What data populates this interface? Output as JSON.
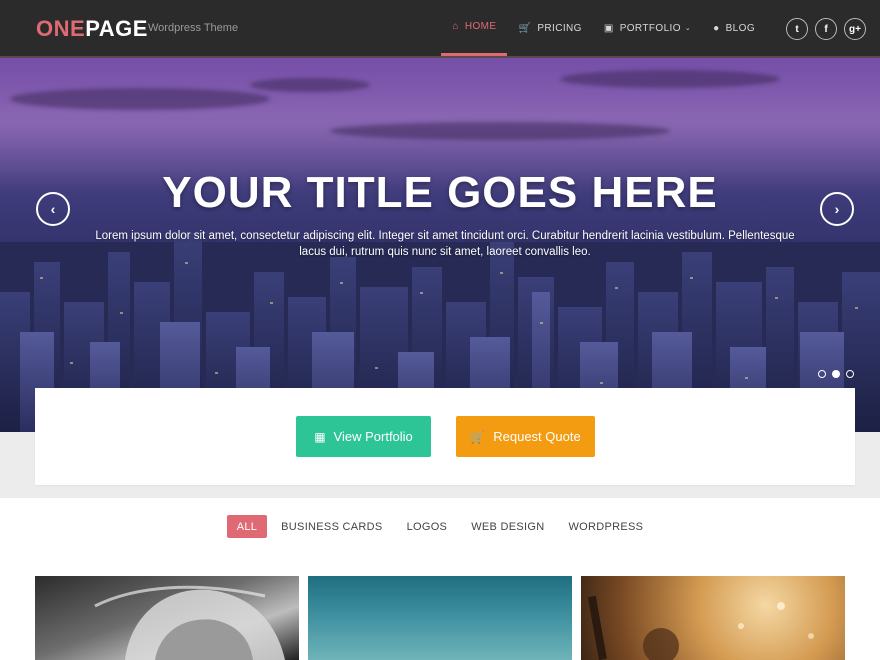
{
  "brand": {
    "part1": "ONE",
    "part2": "PAGE",
    "tagline": "Wordpress Theme"
  },
  "nav": [
    {
      "label": "HOME",
      "icon": "home-icon",
      "glyph": "⌂",
      "active": true
    },
    {
      "label": "PRICING",
      "icon": "cart-icon",
      "glyph": "🛒"
    },
    {
      "label": "PORTFOLIO",
      "icon": "image-icon",
      "glyph": "▣",
      "caret": "⌄"
    },
    {
      "label": "BLOG",
      "icon": "chat-icon",
      "glyph": "●"
    }
  ],
  "social": [
    {
      "icon": "twitter-icon",
      "glyph": "t"
    },
    {
      "icon": "facebook-icon",
      "glyph": "f"
    },
    {
      "icon": "google-plus-icon",
      "glyph": "g+"
    }
  ],
  "hero": {
    "title": "YOUR TITLE GOES HERE",
    "text": "Lorem ipsum dolor sit amet, consectetur adipiscing elit. Integer sit amet tincidunt orci. Curabitur hendrerit lacinia vestibulum. Pellentesque lacus dui, rutrum quis nunc sit amet, laoreet convallis leo.",
    "prev_glyph": "‹",
    "next_glyph": "›",
    "slides": 3,
    "active_slide": 2
  },
  "cta": {
    "portfolio_label": "View Portfolio",
    "portfolio_glyph": "▦",
    "quote_label": "Request Quote",
    "quote_glyph": "🛒"
  },
  "filters": [
    "ALL",
    "BUSINESS CARDS",
    "LOGOS",
    "WEB DESIGN",
    "WORDPRESS"
  ],
  "colors": {
    "accent": "#e06a74",
    "green": "#2ec596",
    "orange": "#f39c12",
    "header": "#2b2b2b"
  }
}
